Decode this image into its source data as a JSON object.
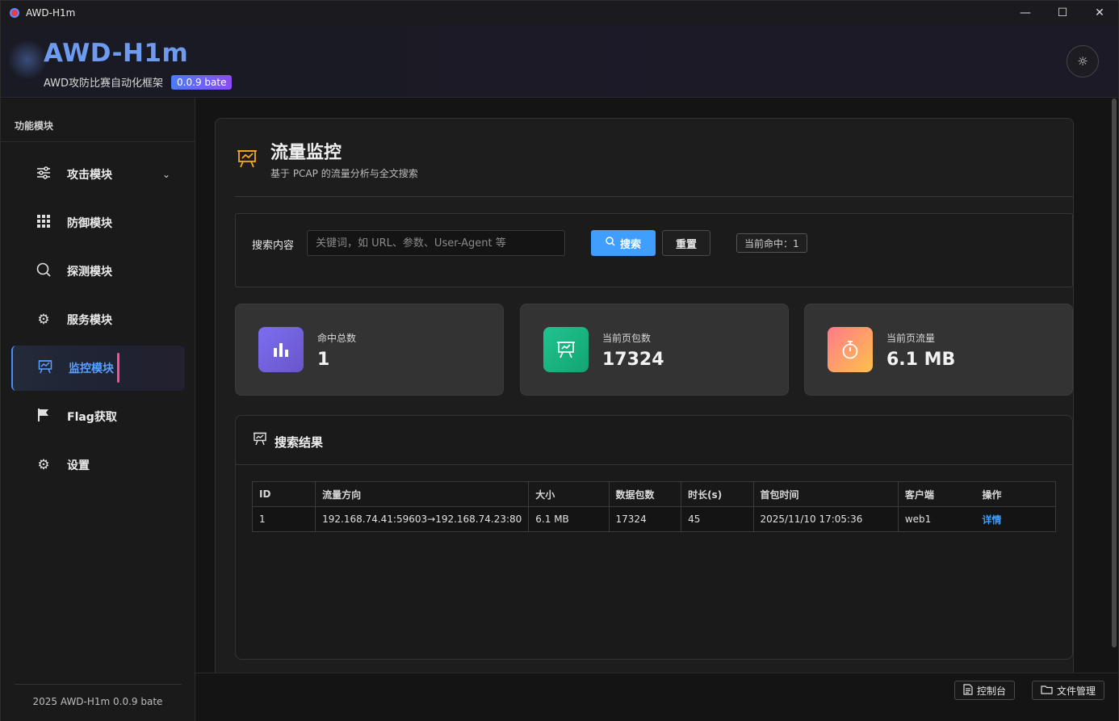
{
  "window": {
    "title": "AWD-H1m",
    "minimize": "—",
    "maximize": "☐",
    "close": "✕"
  },
  "header": {
    "brand": "AWD-H1m",
    "subtitle": "AWD攻防比赛自动化框架",
    "version": "0.0.9 bate",
    "theme_icon": "sun-icon"
  },
  "sidebar": {
    "heading": "功能模块",
    "items": [
      {
        "label": "攻击模块",
        "icon": "sliders-icon",
        "has_chevron": true
      },
      {
        "label": "防御模块",
        "icon": "grid-icon"
      },
      {
        "label": "探测模块",
        "icon": "search-icon"
      },
      {
        "label": "服务模块",
        "icon": "gear-icon"
      },
      {
        "label": "监控模块",
        "icon": "monitor-chart-icon",
        "active": true
      },
      {
        "label": "Flag获取",
        "icon": "flag-icon"
      },
      {
        "label": "设置",
        "icon": "gear-icon"
      }
    ],
    "footer": "2025 AWD-H1m 0.0.9 bate"
  },
  "page": {
    "title": "流量监控",
    "description": "基于 PCAP 的流量分析与全文搜索"
  },
  "search": {
    "label": "搜索内容",
    "placeholder": "关键词，如 URL、参数、User-Agent 等",
    "value": "",
    "search_button": "搜索",
    "reset_button": "重置",
    "hit_text": "当前命中：1"
  },
  "stats": [
    {
      "label": "命中总数",
      "value": "1",
      "icon": "bar-chart-icon",
      "color_from": "#7b6ff0",
      "color_to": "#6a55c9"
    },
    {
      "label": "当前页包数",
      "value": "17324",
      "icon": "presentation-chart-icon",
      "color_from": "#21c38f",
      "color_to": "#12a572"
    },
    {
      "label": "当前页流量",
      "value": "6.1 MB",
      "icon": "stopwatch-icon",
      "color_from": "#ff7a8a",
      "color_to": "#ffc14a"
    }
  ],
  "results": {
    "title": "搜索结果",
    "columns": [
      "ID",
      "流量方向",
      "大小",
      "数据包数",
      "时长(s)",
      "首包时间",
      "客户端",
      "操作"
    ],
    "rows": [
      {
        "id": "1",
        "direction": "192.168.74.41:59603→192.168.74.23:80",
        "size": "6.1 MB",
        "packets": "17324",
        "duration": "45",
        "first_time": "2025/11/10 17:05:36",
        "client": "web1",
        "action": "详情"
      }
    ]
  },
  "bottombar": {
    "console": "控制台",
    "files": "文件管理"
  },
  "colors": {
    "accent": "#409eff",
    "active_marker": "#ff4d94",
    "brand": "#6e9bf0",
    "page_icon": "#f5a623"
  }
}
